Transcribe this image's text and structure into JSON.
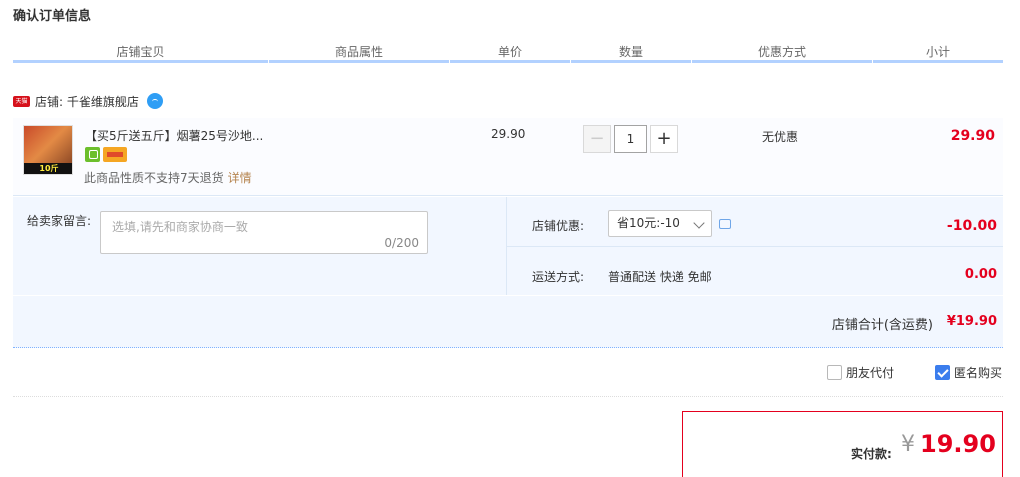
{
  "page": {
    "title": "确认订单信息"
  },
  "columns": [
    "店铺宝贝",
    "商品属性",
    "单价",
    "数量",
    "优惠方式",
    "小计"
  ],
  "shop": {
    "label": "店铺: 千雀维旗舰店",
    "badge": "天猫"
  },
  "item": {
    "title": "【买5斤送五斤】烟薯25号沙地...",
    "thumb_badge": "10斤",
    "return_note": "此商品性质不支持7天退货",
    "detail_link": "详情",
    "unit_price": "29.90",
    "quantity": "1",
    "discount": "无优惠",
    "subtotal": "29.90"
  },
  "message": {
    "label": "给卖家留言:",
    "placeholder": "选填,请先和商家协商一致",
    "count": "0/200"
  },
  "promotion": {
    "label": "店铺优惠:",
    "selected": "省10元:-10",
    "value": "-10.00"
  },
  "shipping": {
    "label": "运送方式:",
    "method": "普通配送 快递 免邮",
    "fee": "0.00"
  },
  "shop_total": {
    "label": "店铺合计(含运费)",
    "value": "¥19.90"
  },
  "options": {
    "friend_pay": "朋友代付",
    "anonymous": "匿名购买",
    "anonymous_checked": true,
    "friend_pay_checked": false
  },
  "payment": {
    "label": "实付款:",
    "currency": "¥",
    "amount": "19.90"
  },
  "colors": {
    "accent": "#e4001e",
    "link_blue": "#3b7ded",
    "panel_bg": "#f2f7ff"
  }
}
